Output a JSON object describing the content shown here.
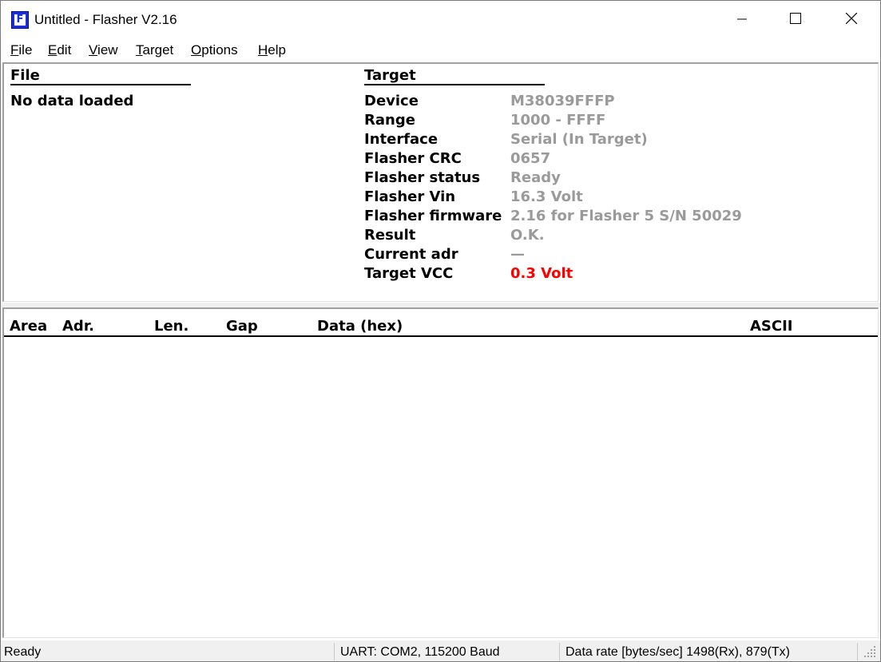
{
  "window": {
    "title": "Untitled - Flasher V2.16",
    "icon": "flasher-app-icon",
    "controls": [
      "minimize-icon",
      "maximize-icon",
      "close-icon"
    ]
  },
  "menu": {
    "items": [
      {
        "key": "F",
        "rest": "ile"
      },
      {
        "key": "E",
        "rest": "dit"
      },
      {
        "key": "V",
        "rest": "iew"
      },
      {
        "key": "T",
        "rest": "arget"
      },
      {
        "key": "O",
        "rest": "ptions"
      },
      {
        "key": "H",
        "rest": "elp"
      }
    ]
  },
  "file_panel": {
    "header": "File",
    "status": "No data loaded"
  },
  "target_panel": {
    "header": "Target",
    "rows": [
      {
        "label": "Device",
        "value": "M38039FFFP"
      },
      {
        "label": "Range",
        "value": "1000 - FFFF"
      },
      {
        "label": "Interface",
        "value": "Serial (In Target)"
      },
      {
        "label": "Flasher CRC",
        "value": "0657"
      },
      {
        "label": "Flasher status",
        "value": "Ready"
      },
      {
        "label": "Flasher Vin",
        "value": "16.3 Volt"
      },
      {
        "label": "Flasher firmware",
        "value": "2.16 for Flasher 5 S/N 50029"
      },
      {
        "label": "Result",
        "value": "O.K."
      },
      {
        "label": "Current adr",
        "value": "—"
      },
      {
        "label": "Target VCC",
        "value": "0.3 Volt"
      }
    ],
    "alert_color": "#ff0000",
    "value_color": "#9a9a9a"
  },
  "data_table": {
    "columns": [
      "Area",
      "Adr.",
      "Len.",
      "Gap",
      "Data (hex)",
      "ASCII"
    ],
    "rows": []
  },
  "statusbar": {
    "state": "Ready",
    "connection": "UART: COM2, 115200 Baud",
    "data_rate": "Data rate [bytes/sec] 1498(Rx), 879(Tx)"
  }
}
